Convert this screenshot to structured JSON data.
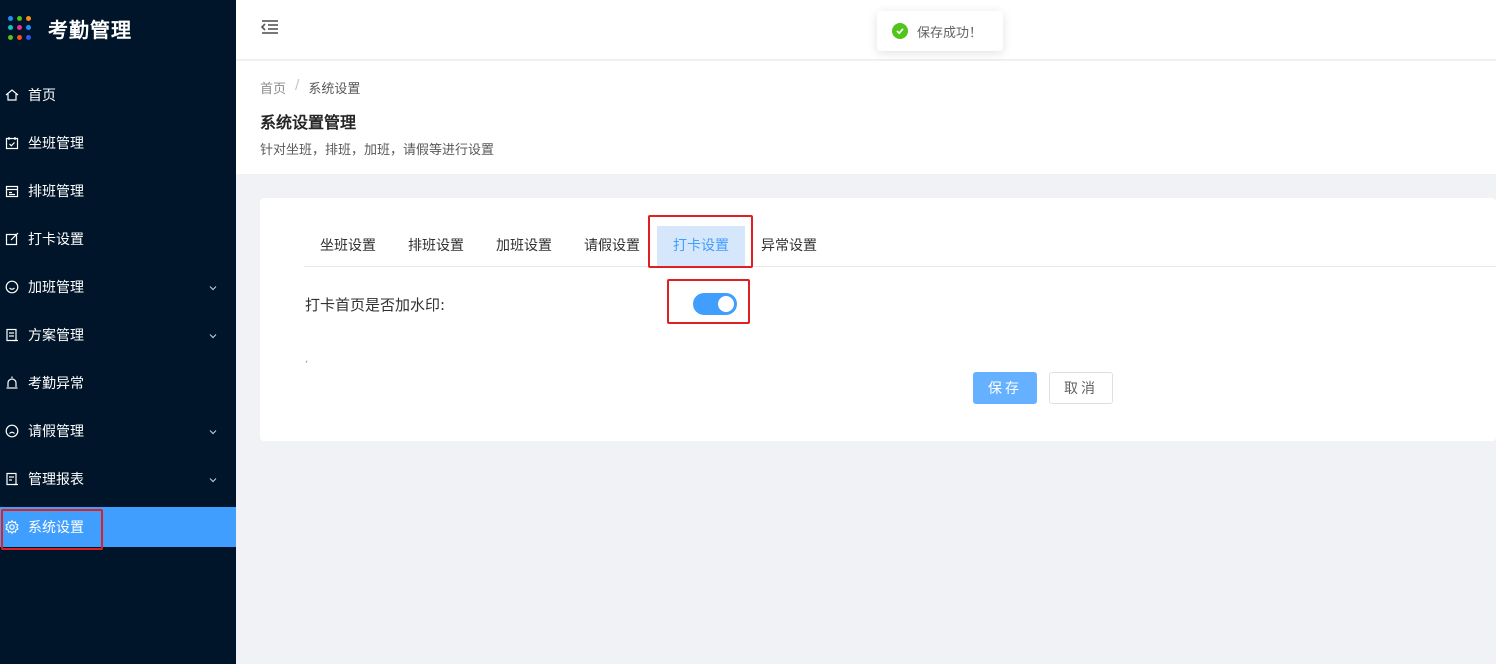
{
  "app": {
    "title": "考勤管理"
  },
  "logo_dots": [
    "#1890ff",
    "#52c41a",
    "#fa8c16",
    "#13c2c2",
    "#eb2f96",
    "#1890ff",
    "#52c41a",
    "#fa541c",
    "#2f54eb"
  ],
  "sidebar": {
    "items": [
      {
        "label": "首页",
        "icon": "home-icon",
        "expandable": false,
        "active": false
      },
      {
        "label": "坐班管理",
        "icon": "calendar-check-icon",
        "expandable": false,
        "active": false
      },
      {
        "label": "排班管理",
        "icon": "schedule-icon",
        "expandable": false,
        "active": false
      },
      {
        "label": "打卡设置",
        "icon": "edit-icon",
        "expandable": false,
        "active": false
      },
      {
        "label": "加班管理",
        "icon": "smile-icon",
        "expandable": true,
        "active": false
      },
      {
        "label": "方案管理",
        "icon": "document-icon",
        "expandable": true,
        "active": false
      },
      {
        "label": "考勤异常",
        "icon": "alarm-icon",
        "expandable": false,
        "active": false
      },
      {
        "label": "请假管理",
        "icon": "frown-icon",
        "expandable": true,
        "active": false
      },
      {
        "label": "管理报表",
        "icon": "report-icon",
        "expandable": true,
        "active": false
      },
      {
        "label": "系统设置",
        "icon": "gear-icon",
        "expandable": false,
        "active": true
      }
    ]
  },
  "toast": {
    "message": "保存成功！",
    "icon": "success-check-icon",
    "color": "#52c41a"
  },
  "breadcrumb": {
    "home": "首页",
    "separator": "/",
    "current": "系统设置"
  },
  "page": {
    "title": "系统设置管理",
    "description": "针对坐班，排班，加班，请假等进行设置"
  },
  "tabs": [
    {
      "label": "坐班设置",
      "active": false
    },
    {
      "label": "排班设置",
      "active": false
    },
    {
      "label": "加班设置",
      "active": false
    },
    {
      "label": "请假设置",
      "active": false
    },
    {
      "label": "打卡设置",
      "active": true
    },
    {
      "label": "异常设置",
      "active": false
    }
  ],
  "form": {
    "watermark_label": "打卡首页是否加水印:",
    "watermark_enabled": true,
    "tiny_mark": ","
  },
  "buttons": {
    "save": "保存",
    "cancel": "取消"
  },
  "colors": {
    "sidebar_bg": "#001529",
    "accent": "#409eff",
    "highlight_box": "#e02020"
  }
}
